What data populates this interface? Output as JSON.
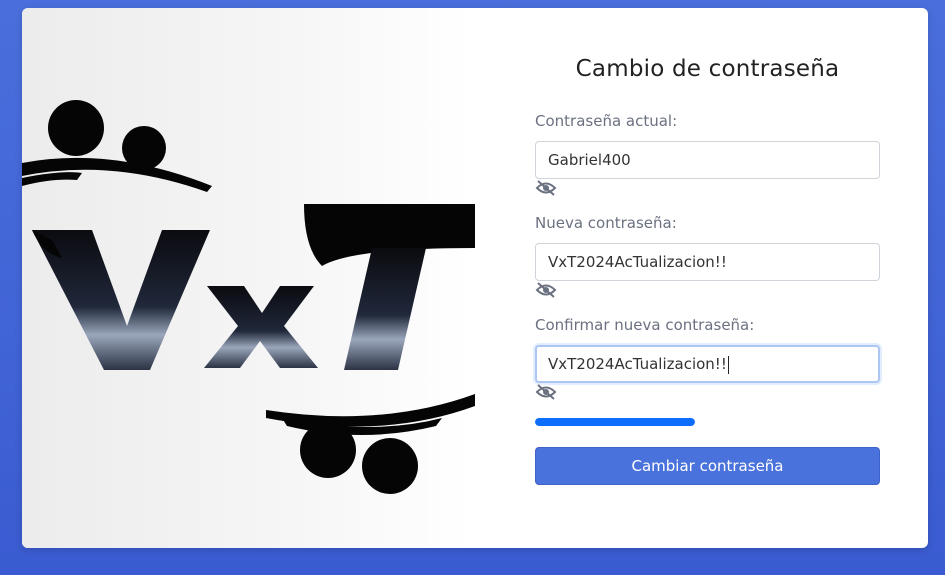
{
  "form": {
    "title": "Cambio de contraseña",
    "fields": [
      {
        "label": "Contraseña actual:",
        "value": "Gabriel400",
        "toggle_icon": "eye-slash-icon"
      },
      {
        "label": "Nueva contraseña:",
        "value": "VxT2024AcTualizacion!!",
        "toggle_icon": "eye-slash-icon"
      },
      {
        "label": "Confirmar nueva contraseña:",
        "value": "VxT2024AcTualizacion!!",
        "toggle_icon": "eye-slash-icon"
      }
    ],
    "strength": {
      "level": 1.0,
      "color": "#0d6efd"
    },
    "submit_label": "Cambiar contraseña"
  },
  "logo": {
    "text": "VxT"
  },
  "colors": {
    "background": "#3f62d6",
    "button": "#4a72dc",
    "label": "#6b7180"
  }
}
